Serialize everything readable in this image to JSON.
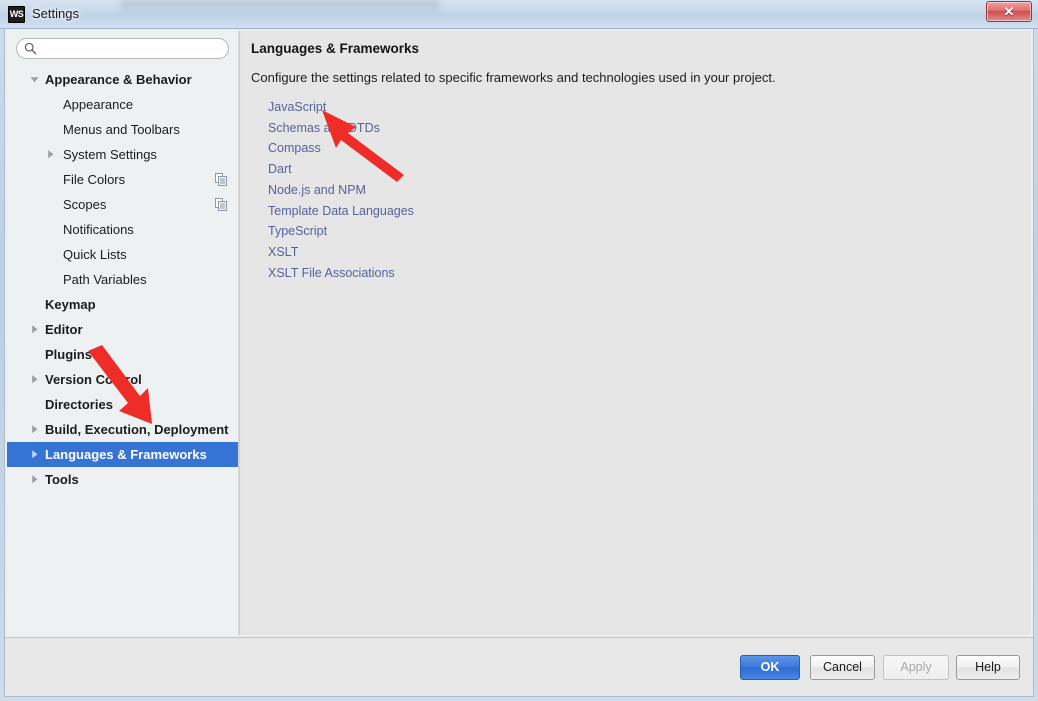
{
  "window": {
    "title": "Settings",
    "app_icon": "WS",
    "close_label": "✕"
  },
  "search": {
    "placeholder": "",
    "value": "",
    "icon": "search-icon"
  },
  "sidebar": {
    "items": [
      {
        "label": "Appearance & Behavior",
        "level": 0,
        "twisty": "expanded",
        "bold": true,
        "selected": false,
        "trail_icon": ""
      },
      {
        "label": "Appearance",
        "level": 1,
        "twisty": "none",
        "bold": false,
        "selected": false,
        "trail_icon": ""
      },
      {
        "label": "Menus and Toolbars",
        "level": 1,
        "twisty": "none",
        "bold": false,
        "selected": false,
        "trail_icon": ""
      },
      {
        "label": "System Settings",
        "level": 1,
        "twisty": "collapsed",
        "bold": false,
        "selected": false,
        "trail_icon": ""
      },
      {
        "label": "File Colors",
        "level": 1,
        "twisty": "none",
        "bold": false,
        "selected": false,
        "trail_icon": "copy-scope-icon"
      },
      {
        "label": "Scopes",
        "level": 1,
        "twisty": "none",
        "bold": false,
        "selected": false,
        "trail_icon": "copy-scope-icon"
      },
      {
        "label": "Notifications",
        "level": 1,
        "twisty": "none",
        "bold": false,
        "selected": false,
        "trail_icon": ""
      },
      {
        "label": "Quick Lists",
        "level": 1,
        "twisty": "none",
        "bold": false,
        "selected": false,
        "trail_icon": ""
      },
      {
        "label": "Path Variables",
        "level": 1,
        "twisty": "none",
        "bold": false,
        "selected": false,
        "trail_icon": ""
      },
      {
        "label": "Keymap",
        "level": 0,
        "twisty": "none",
        "bold": true,
        "selected": false,
        "trail_icon": ""
      },
      {
        "label": "Editor",
        "level": 0,
        "twisty": "collapsed",
        "bold": true,
        "selected": false,
        "trail_icon": ""
      },
      {
        "label": "Plugins",
        "level": 0,
        "twisty": "none",
        "bold": true,
        "selected": false,
        "trail_icon": ""
      },
      {
        "label": "Version Control",
        "level": 0,
        "twisty": "collapsed",
        "bold": true,
        "selected": false,
        "trail_icon": ""
      },
      {
        "label": "Directories",
        "level": 0,
        "twisty": "none",
        "bold": true,
        "selected": false,
        "trail_icon": ""
      },
      {
        "label": "Build, Execution, Deployment",
        "level": 0,
        "twisty": "collapsed",
        "bold": true,
        "selected": false,
        "trail_icon": ""
      },
      {
        "label": "Languages & Frameworks",
        "level": 0,
        "twisty": "collapsed",
        "bold": true,
        "selected": true,
        "trail_icon": ""
      },
      {
        "label": "Tools",
        "level": 0,
        "twisty": "collapsed",
        "bold": true,
        "selected": false,
        "trail_icon": ""
      }
    ]
  },
  "panel": {
    "title": "Languages & Frameworks",
    "description": "Configure the settings related to specific frameworks and technologies used in your project.",
    "links": [
      "JavaScript",
      "Schemas and DTDs",
      "Compass",
      "Dart",
      "Node.js and NPM",
      "Template Data Languages",
      "TypeScript",
      "XSLT",
      "XSLT File Associations"
    ]
  },
  "footer": {
    "ok": "OK",
    "cancel": "Cancel",
    "apply": "Apply",
    "help": "Help"
  },
  "annotations": {
    "arrow_color": "#ef2d28",
    "arrows": [
      {
        "name": "arrow-to-javascript",
        "points_to": "JavaScript"
      },
      {
        "name": "arrow-to-languages-frameworks",
        "points_to": "Languages & Frameworks"
      }
    ]
  },
  "colors": {
    "selection": "#3573d4",
    "link": "#55639b",
    "primary_button": "#3c79dd",
    "sidebar_bg": "#edf1f2",
    "panel_bg": "#e6e6e6"
  }
}
